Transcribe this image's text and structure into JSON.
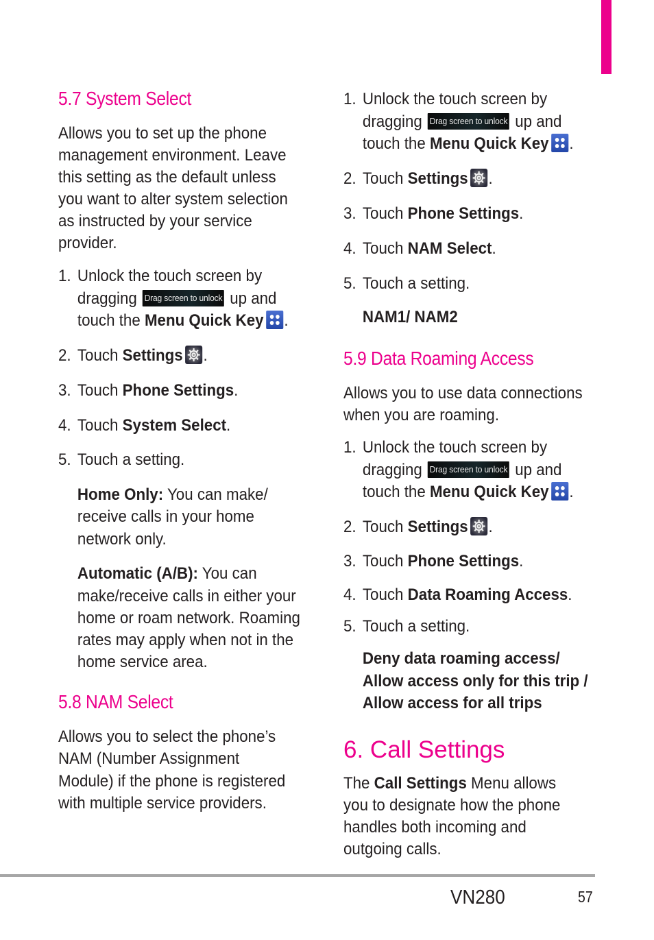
{
  "accent_color": "#ec008c",
  "left": {
    "s57": {
      "heading": "5.7 System Select",
      "intro": [
        "Allows you to set up the phone",
        "management environment. Leave",
        "this setting as the default unless",
        "you want to alter system selection",
        "as instructed by your service",
        "provider."
      ],
      "step1": {
        "num": "1.",
        "l1": "Unlock the touch screen by",
        "l2a": "dragging",
        "drag_label": "Drag screen to unlock",
        "l2b": "up and",
        "l3a": "touch the",
        "l3b": "Menu Quick Key",
        "l3c": "."
      },
      "step2": {
        "num": "2.",
        "a": "Touch",
        "b": "Settings",
        "c": "."
      },
      "step3": {
        "num": "3.",
        "a": "Touch",
        "b": "Phone Settings",
        "c": "."
      },
      "step4": {
        "num": "4.",
        "a": "Touch",
        "b": "System Select",
        "c": "."
      },
      "step5": {
        "num": "5.",
        "a": "Touch a setting."
      },
      "opt1": {
        "label": "Home Only:",
        "l1": " You can make/",
        "l2": "receive calls in your home",
        "l3": "network only."
      },
      "opt2": {
        "label": "Automatic (A/B):",
        "l1": " You can",
        "l2": "make/receive calls in either your",
        "l3": "home or roam network. Roaming",
        "l4": "rates may apply when not in the",
        "l5": "home service area."
      }
    },
    "s58": {
      "heading": "5.8 NAM Select",
      "intro": [
        "Allows you to select the phone’s",
        "NAM (Number Assignment",
        "Module) if the phone is registered",
        "with multiple service providers."
      ]
    }
  },
  "right": {
    "s58steps": {
      "step1": {
        "num": "1.",
        "l1": "Unlock the touch screen by",
        "l2a": "dragging",
        "drag_label": "Drag screen to unlock",
        "l2b": "up and",
        "l3a": "touch the",
        "l3b": "Menu Quick Key",
        "l3c": "."
      },
      "step2": {
        "num": "2.",
        "a": "Touch",
        "b": "Settings",
        "c": "."
      },
      "step3": {
        "num": "3.",
        "a": "Touch",
        "b": "Phone Settings",
        "c": "."
      },
      "step4": {
        "num": "4.",
        "a": "Touch",
        "b": "NAM Select",
        "c": "."
      },
      "step5": {
        "num": "5.",
        "a": "Touch a setting."
      },
      "options": "NAM1/ NAM2"
    },
    "s59": {
      "heading": "5.9 Data Roaming Access",
      "intro": [
        "Allows you to use data connections",
        "when you are roaming."
      ],
      "step1": {
        "num": "1.",
        "l1": "Unlock the touch screen by",
        "l2a": "dragging",
        "drag_label": "Drag screen to unlock",
        "l2b": "up and",
        "l3a": "touch the",
        "l3b": "Menu Quick Key",
        "l3c": "."
      },
      "step2": {
        "num": "2.",
        "a": "Touch",
        "b": "Settings",
        "c": "."
      },
      "step3": {
        "num": "3.",
        "a": "Touch",
        "b": "Phone Settings",
        "c": "."
      },
      "step4": {
        "num": "4.",
        "a": "Touch",
        "b": "Data Roaming Access",
        "c": "."
      },
      "step5": {
        "num": "5.",
        "a": "Touch a setting."
      },
      "options": [
        "Deny data roaming access/",
        "Allow access only for this trip /",
        "Allow access for all trips"
      ]
    },
    "s6": {
      "heading": "6. Call Settings",
      "l1a": "The",
      "l1b": "Call Settings",
      "l1c": "Menu allows",
      "lines": [
        "you to designate how the phone",
        "handles both incoming and",
        "outgoing calls."
      ]
    }
  },
  "footer": {
    "model": "VN280",
    "page": "57"
  }
}
